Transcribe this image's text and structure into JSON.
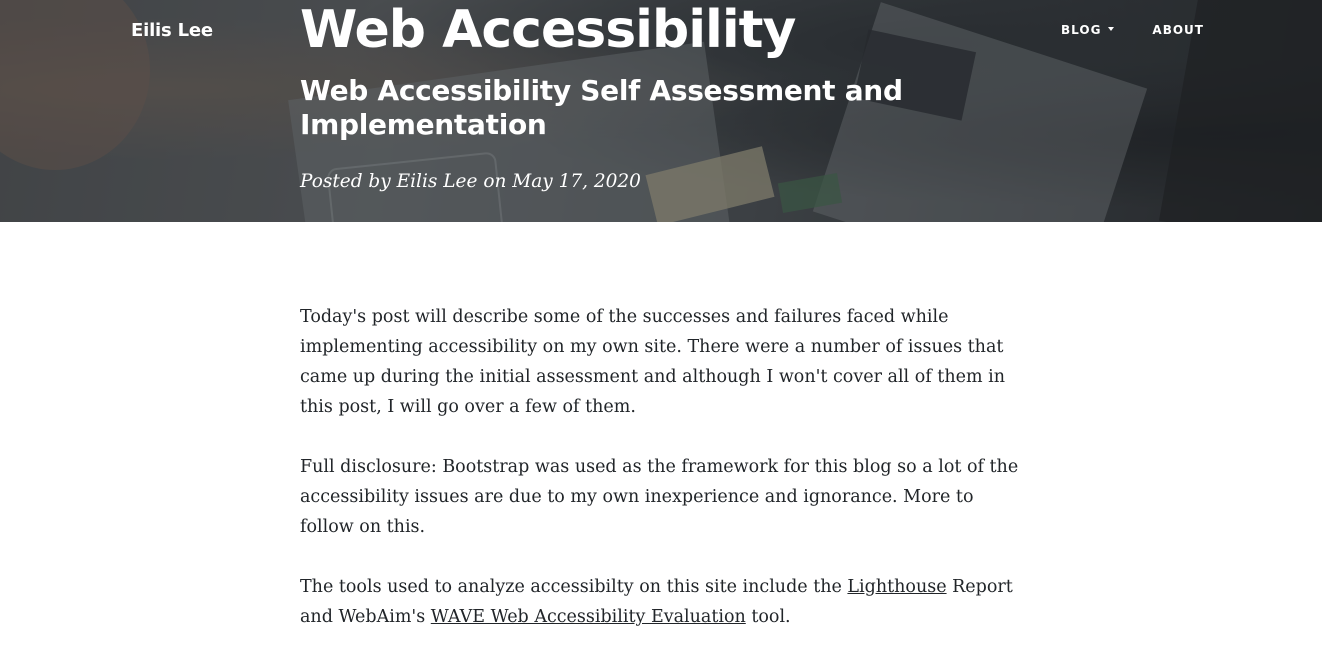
{
  "brand": "Eilis Lee",
  "nav": {
    "blog_label": "BLOG",
    "about_label": "ABOUT"
  },
  "header": {
    "title": "Web Accessibility",
    "subtitle": "Web Accessibility Self Assessment and Implementation",
    "meta_prefix": "Posted by ",
    "author": "Eilis Lee",
    "meta_mid": " on ",
    "date": "May 17, 2020"
  },
  "article": {
    "p1": "Today's post will describe some of the successes and failures faced while implementing accessibility on my own site. There were a number of issues that came up during the initial assessment and although I won't cover all of them in this post, I will go over a few of them.",
    "p2": "Full disclosure: Bootstrap was used as the framework for this blog so a lot of the accessibility issues are due to my own inexperience and ignorance. More to follow on this.",
    "p3_before": "The tools used to analyze accessibilty on this site include the ",
    "link_lighthouse": "Lighthouse",
    "p3_middle": " Report and WebAim's ",
    "link_wave": "WAVE Web Accessibility Evaluation",
    "p3_after": " tool."
  }
}
